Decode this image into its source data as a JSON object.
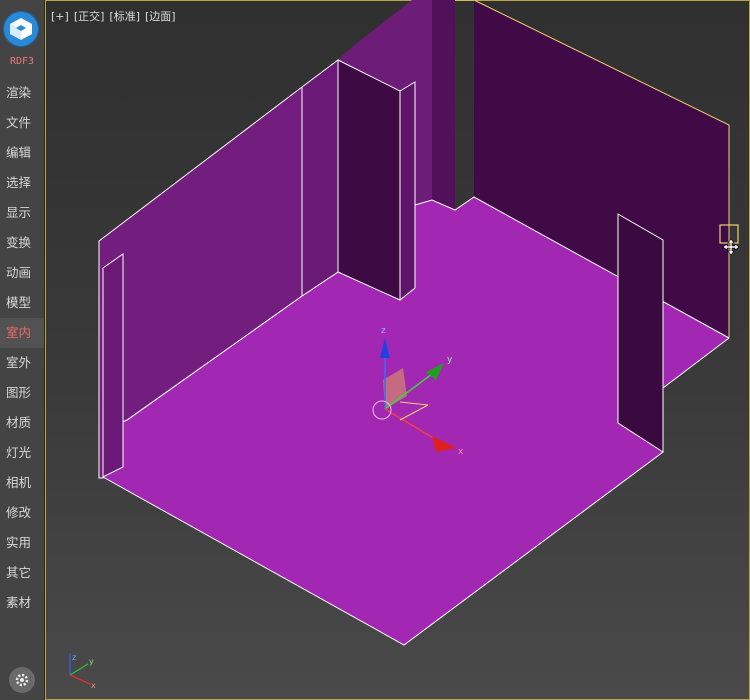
{
  "brand": "RDF3",
  "menu": [
    {
      "label": "渲染"
    },
    {
      "label": "文件"
    },
    {
      "label": "编辑"
    },
    {
      "label": "选择"
    },
    {
      "label": "显示"
    },
    {
      "label": "变换"
    },
    {
      "label": "动画"
    },
    {
      "label": "模型"
    },
    {
      "label": "室内",
      "active": true
    },
    {
      "label": "室外"
    },
    {
      "label": "图形"
    },
    {
      "label": "材质"
    },
    {
      "label": "灯光"
    },
    {
      "label": "相机"
    },
    {
      "label": "修改"
    },
    {
      "label": "实用"
    },
    {
      "label": "其它"
    },
    {
      "label": "素材"
    }
  ],
  "viewport": {
    "labels": [
      "[+]",
      "[正交]",
      "[标准]",
      "[边面]"
    ],
    "gizmo_axes": {
      "x": "x",
      "y": "y",
      "z": "z"
    },
    "corner_axes": {
      "x": "x",
      "y": "y",
      "z": "z"
    }
  },
  "colors": {
    "floor": "#a028b0",
    "wall_left": "#731d7f",
    "wall_back": "#420b48",
    "edge": "#ffffff",
    "selection": "#f0d070",
    "active_menu": "#f06a6a"
  }
}
